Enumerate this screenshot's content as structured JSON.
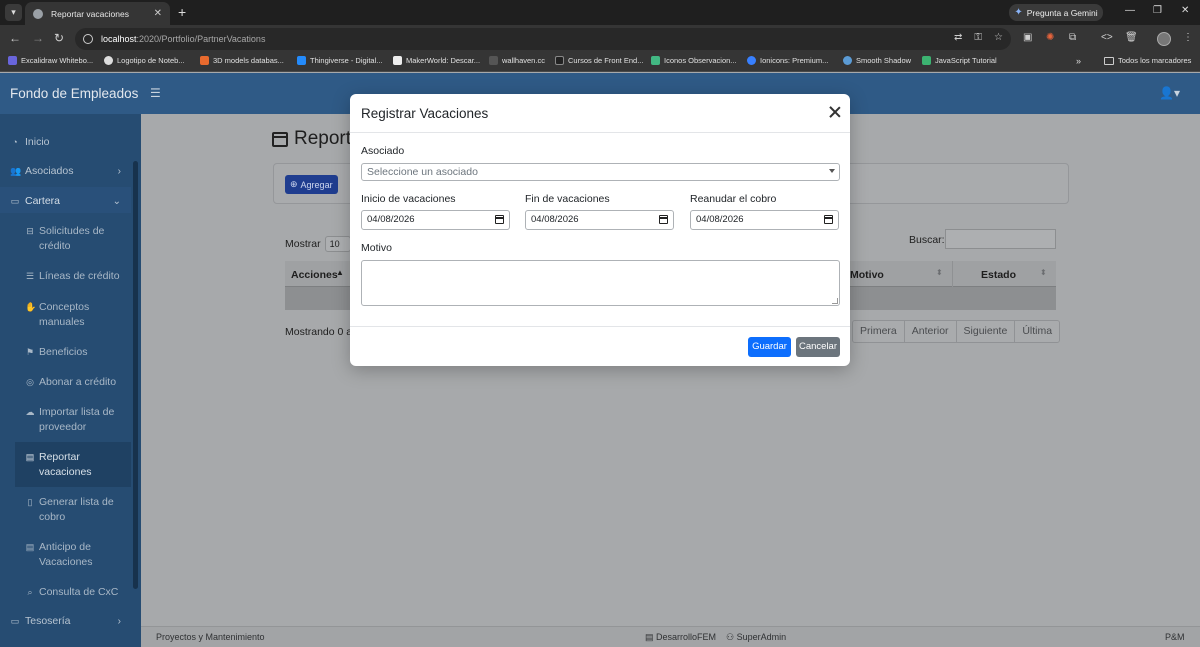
{
  "browser": {
    "tab_title": "Reportar vacaciones",
    "gemini_label": "Pregunta a Gemini",
    "url_host": "localhost",
    "url_path": ":2020/Portfolio/PartnerVacations",
    "bookmarks": [
      "Excalidraw Whitebo...",
      "Logotipo de Noteb...",
      "3D models databas...",
      "Thingiverse - Digital...",
      "MakerWorld: Descar...",
      "wallhaven.cc",
      "Cursos de Front End...",
      "Iconos Observacion...",
      "Ionicons: Premium...",
      "Smooth Shadow",
      "JavaScript Tutorial"
    ],
    "all_bookmarks_label": "Todos los marcadores"
  },
  "app": {
    "brand": "Fondo de Empleados",
    "sidebar": {
      "inicio": "Inicio",
      "asociados": "Asociados",
      "cartera": "Cartera",
      "sub_items": [
        "Solicitudes de crédito",
        "Líneas de crédito",
        "Conceptos manuales",
        "Beneficios",
        "Abonar a crédito",
        "Importar lista de proveedor",
        "Reportar vacaciones",
        "Generar lista de cobro",
        "Anticipo de Vacaciones",
        "Consulta de CxC"
      ],
      "tesoreria": "Tesosería"
    },
    "page_title": "Report",
    "add_button": "Agregar",
    "show_label": "Mostrar",
    "show_value": "10",
    "search_label": "Buscar:",
    "table_headers": [
      "Acciones",
      "Motivo",
      "Estado"
    ],
    "showing_text": "Mostrando 0 a",
    "pager": [
      "Primera",
      "Anterior",
      "Siguiente",
      "Última"
    ],
    "footer": {
      "left": "Proyectos y Mantenimiento",
      "db": "DesarrolloFEM",
      "user": "SuperAdmin",
      "right": "P&M"
    }
  },
  "modal": {
    "title": "Registrar Vacaciones",
    "asociado_label": "Asociado",
    "asociado_placeholder": "Seleccione un asociado",
    "inicio_label": "Inicio de vacaciones",
    "inicio_value": "04/08/2026",
    "fin_label": "Fin de vacaciones",
    "fin_value": "04/08/2026",
    "reanudar_label": "Reanudar el cobro",
    "reanudar_value": "04/08/2026",
    "motivo_label": "Motivo",
    "motivo_value": "",
    "save_label": "Guardar",
    "cancel_label": "Cancelar"
  },
  "colors": {
    "header_blue": "#2f5a86",
    "sidebar_blue": "#264c72",
    "primary": "#0d6efd",
    "secondary": "#6c757d"
  }
}
